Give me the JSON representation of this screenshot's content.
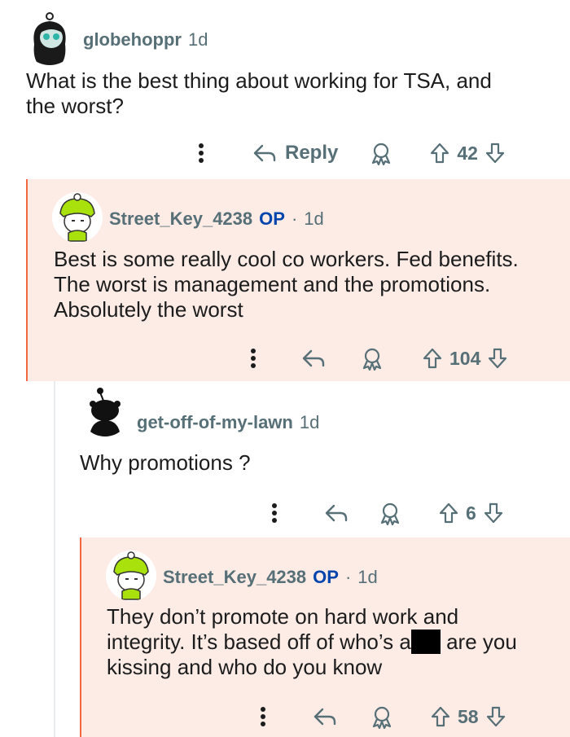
{
  "comments": [
    {
      "username": "globehoppr",
      "time": "1d",
      "text": "What is the best thing about working for TSA, and the worst?",
      "text_lines": [
        "What is the best thing about working for TSA, and",
        "the worst?"
      ],
      "reply_label": "Reply",
      "votes": "42"
    },
    {
      "username": "Street_Key_4238",
      "op_badge": "OP",
      "separator": "·",
      "time": "1d",
      "text_lines": [
        "Best is some really cool co workers. Fed benefits.",
        "The worst is management and the promotions.",
        "Absolutely the worst"
      ],
      "votes": "104"
    },
    {
      "username": "get-off-of-my-lawn",
      "time": "1d",
      "text_lines": [
        "Why promotions ?"
      ],
      "votes": "6"
    },
    {
      "username": "Street_Key_4238",
      "op_badge": "OP",
      "separator": "·",
      "time": "1d",
      "text_line1": "They don’t promote on hard work and",
      "text_line2_a": "integrity. It’s based off of who’s a",
      "text_line2_b": " are you",
      "text_line3": "kissing and who do you know",
      "votes": "58"
    }
  ],
  "colors": {
    "highlight_bg": "#fdebe6",
    "highlight_bar": "#f1683f",
    "op_blue": "#0045ac",
    "meta_gray": "#576f76"
  }
}
